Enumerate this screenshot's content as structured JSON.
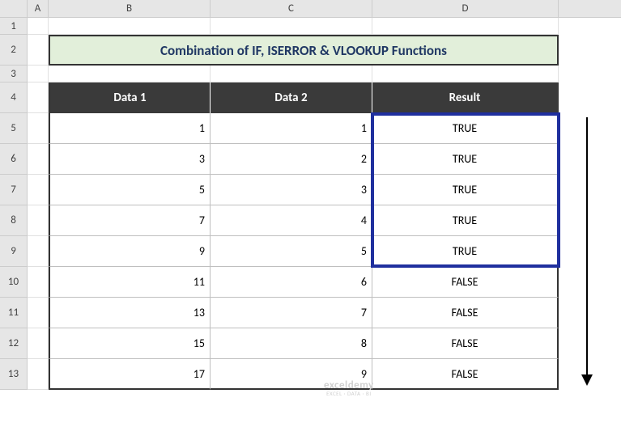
{
  "columns": {
    "A": "A",
    "B": "B",
    "C": "C",
    "D": "D"
  },
  "rows": [
    "1",
    "2",
    "3",
    "4",
    "5",
    "6",
    "7",
    "8",
    "9",
    "10",
    "11",
    "12",
    "13"
  ],
  "title": "Combination of IF, ISERROR & VLOOKUP  Functions",
  "headers": {
    "data1": "Data 1",
    "data2": "Data 2",
    "result": "Result"
  },
  "data": [
    {
      "d1": "1",
      "d2": "1",
      "r": "TRUE"
    },
    {
      "d1": "3",
      "d2": "2",
      "r": "TRUE"
    },
    {
      "d1": "5",
      "d2": "3",
      "r": "TRUE"
    },
    {
      "d1": "7",
      "d2": "4",
      "r": "TRUE"
    },
    {
      "d1": "9",
      "d2": "5",
      "r": "TRUE"
    },
    {
      "d1": "11",
      "d2": "6",
      "r": "FALSE"
    },
    {
      "d1": "13",
      "d2": "7",
      "r": "FALSE"
    },
    {
      "d1": "15",
      "d2": "8",
      "r": "FALSE"
    },
    {
      "d1": "17",
      "d2": "9",
      "r": "FALSE"
    }
  ],
  "watermark": {
    "main": "exceldemy",
    "sub": "EXCEL · DATA · BI"
  },
  "chart_data": {
    "type": "table",
    "title": "Combination of IF, ISERROR & VLOOKUP Functions",
    "columns": [
      "Data 1",
      "Data 2",
      "Result"
    ],
    "rows": [
      [
        1,
        1,
        "TRUE"
      ],
      [
        3,
        2,
        "TRUE"
      ],
      [
        5,
        3,
        "TRUE"
      ],
      [
        7,
        4,
        "TRUE"
      ],
      [
        9,
        5,
        "TRUE"
      ],
      [
        11,
        6,
        "FALSE"
      ],
      [
        13,
        7,
        "FALSE"
      ],
      [
        15,
        8,
        "FALSE"
      ],
      [
        17,
        9,
        "FALSE"
      ]
    ]
  }
}
